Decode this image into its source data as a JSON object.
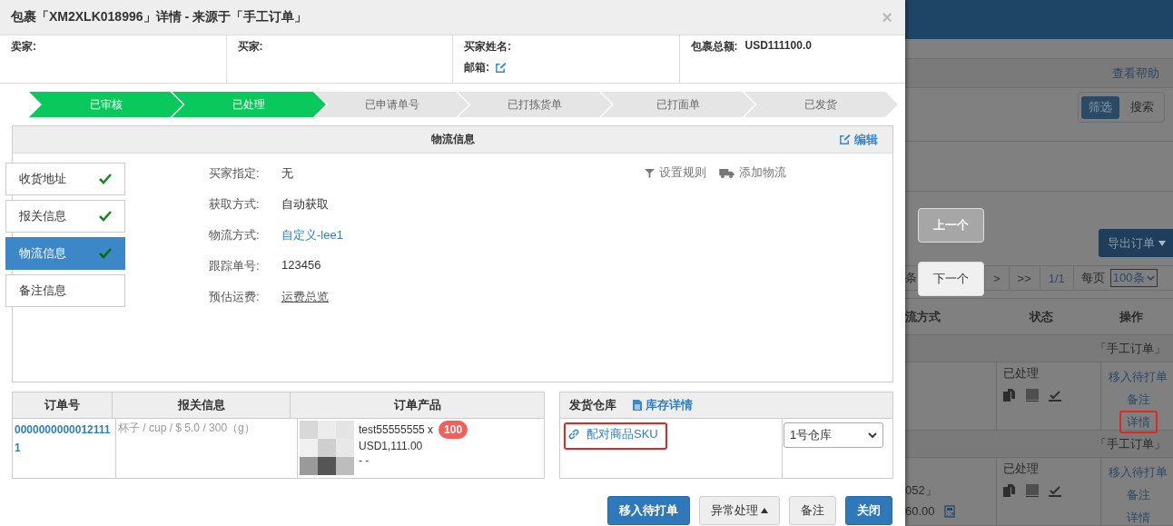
{
  "dialog": {
    "title": "包裹「XM2XLK018996」详情 - 来源于「手工订单」",
    "close": "×"
  },
  "summary": {
    "seller_label": "卖家:",
    "buyer_label": "买家:",
    "buyer_name_label": "买家姓名:",
    "email_label": "邮箱:",
    "total_label": "包裹总额:",
    "total_value": "USD111100.0"
  },
  "steps": [
    {
      "label": "已审核",
      "done": true
    },
    {
      "label": "已处理",
      "done": true
    },
    {
      "label": "已申请单号",
      "done": false
    },
    {
      "label": "已打拣货单",
      "done": false
    },
    {
      "label": "已打面单",
      "done": false
    },
    {
      "label": "已发货",
      "done": false
    }
  ],
  "logistics": {
    "title": "物流信息",
    "edit": "编辑",
    "tabs": [
      {
        "label": "收货地址",
        "checked": true,
        "selected": false
      },
      {
        "label": "报关信息",
        "checked": true,
        "selected": false
      },
      {
        "label": "物流信息",
        "checked": true,
        "selected": true
      },
      {
        "label": "备注信息",
        "checked": false,
        "selected": false
      }
    ],
    "fields": [
      {
        "label": "买家指定:",
        "value": "无",
        "kind": "text"
      },
      {
        "label": "获取方式:",
        "value": "自动获取",
        "kind": "text"
      },
      {
        "label": "物流方式:",
        "value": "自定义-lee1",
        "kind": "link"
      },
      {
        "label": "跟踪单号:",
        "value": "123456",
        "kind": "text"
      },
      {
        "label": "预估运费:",
        "value": "运费总览",
        "kind": "underline"
      }
    ],
    "actions": [
      {
        "label": "设置规则",
        "kind": "filter"
      },
      {
        "label": "添加物流",
        "kind": "truck"
      }
    ]
  },
  "order_table": {
    "columns": [
      "订单号",
      "报关信息",
      "订单产品"
    ],
    "row": {
      "order_no": "00000000000121111",
      "customs": "杯子 / cup / $ 5.0 / 300（g）",
      "product_name": "test55555555 x",
      "quantity": "100",
      "price": "USD1,111.00",
      "note": "- -"
    }
  },
  "warehouse": {
    "title": "发货仓库",
    "stock_link": "库存详情",
    "match_link": {
      "label": "配对商品SKU",
      "highlighted": true
    },
    "select": "1号仓库"
  },
  "footer_buttons": [
    {
      "label": "移入待打单",
      "kind": "primary"
    },
    {
      "label": "异常处理",
      "kind": "dropdown"
    },
    {
      "label": "备注",
      "kind": "default"
    },
    {
      "label": "关闭",
      "kind": "primary"
    }
  ],
  "background": {
    "help": "查看帮助",
    "toggle": [
      {
        "label": "筛选",
        "selected": true
      },
      {
        "label": "搜索",
        "selected": false
      }
    ],
    "export": "导出订单",
    "pager": {
      "count": "条",
      "next": ">",
      "last": ">>",
      "page": "1/1",
      "per_page_label": "每页",
      "per_page": "100条"
    },
    "columns": [
      "流方式",
      "状态",
      "操作"
    ],
    "groups": [
      {
        "source": "「手工订单」",
        "status": "已处理",
        "actions": [
          {
            "label": "移入待打单",
            "highlighted": false
          },
          {
            "label": "备注",
            "highlighted": false
          },
          {
            "label": "详情",
            "highlighted": true
          }
        ]
      },
      {
        "source": "「手工订单」",
        "logistics": "052」",
        "amount": "60.00",
        "status": "已处理",
        "actions": [
          {
            "label": "移入待打单",
            "highlighted": false
          },
          {
            "label": "备注",
            "highlighted": false
          },
          {
            "label": "详情",
            "highlighted": false
          }
        ]
      }
    ]
  },
  "nav": [
    {
      "label": "上一个",
      "disabled": true
    },
    {
      "label": "下一个",
      "disabled": false
    }
  ]
}
